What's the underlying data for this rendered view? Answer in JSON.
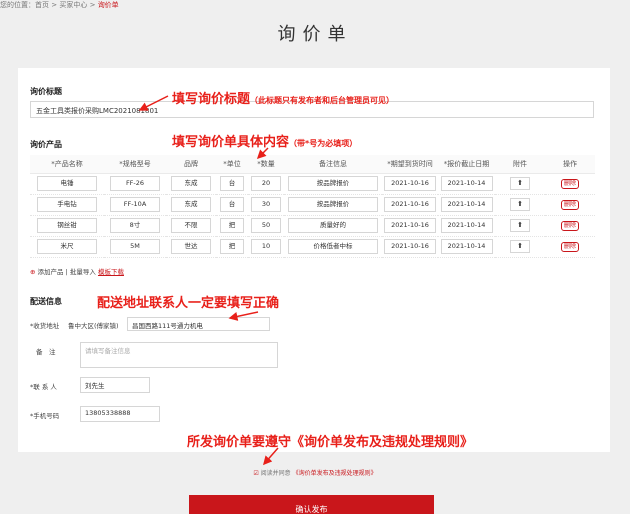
{
  "breadcrumb": {
    "label": "您的位置：",
    "home": "首页",
    "sep": ">",
    "buyer": "买家中心",
    "current": "询价单"
  },
  "page_title": "询价单",
  "title_section": {
    "label": "询价标题",
    "value": "五金工具类报价采购LMC2021081801"
  },
  "product_section": {
    "label": "询价产品",
    "columns": [
      "*产品名称",
      "*规格型号",
      "品牌",
      "*单位",
      "*数量",
      "备注信息",
      "*期望到货时间",
      "*报价截止日期",
      "附件",
      "操作"
    ],
    "rows": [
      {
        "name": "电锤",
        "model": "FF-26",
        "brand": "东成",
        "unit": "台",
        "qty": "20",
        "note": "按品牌报价",
        "arrival": "2021-10-16",
        "deadline": "2021-10-14",
        "upload": "⬆",
        "action": "删除"
      },
      {
        "name": "手电钻",
        "model": "FF-10A",
        "brand": "东成",
        "unit": "台",
        "qty": "30",
        "note": "按品牌报价",
        "arrival": "2021-10-16",
        "deadline": "2021-10-14",
        "upload": "⬆",
        "action": "删除"
      },
      {
        "name": "钢丝钳",
        "model": "8寸",
        "brand": "不限",
        "unit": "把",
        "qty": "50",
        "note": "质量好的",
        "arrival": "2021-10-16",
        "deadline": "2021-10-14",
        "upload": "⬆",
        "action": "删除"
      },
      {
        "name": "米尺",
        "model": "5M",
        "brand": "世达",
        "unit": "把",
        "qty": "10",
        "note": "价格低者中标",
        "arrival": "2021-10-16",
        "deadline": "2021-10-14",
        "upload": "⬆",
        "action": "删除"
      }
    ],
    "add_product": "添加产品",
    "divider": "|",
    "batch_import": "批量导入",
    "template_download": "模板下载"
  },
  "delivery_section": {
    "label": "配送信息",
    "address_label": "*收货地址",
    "address_region": "鲁中大区(傅家镇)",
    "address_value": "昌国西路111号通力机电",
    "remark_label": "备　注",
    "remark_placeholder": "请填写备注信息",
    "contact_label": "*联 系 人",
    "contact_value": "刘先生",
    "phone_label": "*手机号码",
    "phone_value": "13805338888"
  },
  "agree": {
    "checkbox": "☑",
    "text": "阅读并同意",
    "rule_link": "《询价单发布及违规处理规则》"
  },
  "submit_label": "确认发布",
  "annotations": {
    "title_tip": "填写询价标题",
    "title_tip_note": "（此标题只有发布者和后台管理员可见）",
    "content_tip": "填写询价单具体内容",
    "content_tip_note": "（带*号为必填项）",
    "delivery_tip": "配送地址联系人一定要填写正确",
    "rule_tip": "所发询价单要遵守《询价单发布及违规处理规则》"
  },
  "colors": {
    "accent": "#c9161b",
    "annotation": "#e8201a",
    "background": "#efefef"
  }
}
